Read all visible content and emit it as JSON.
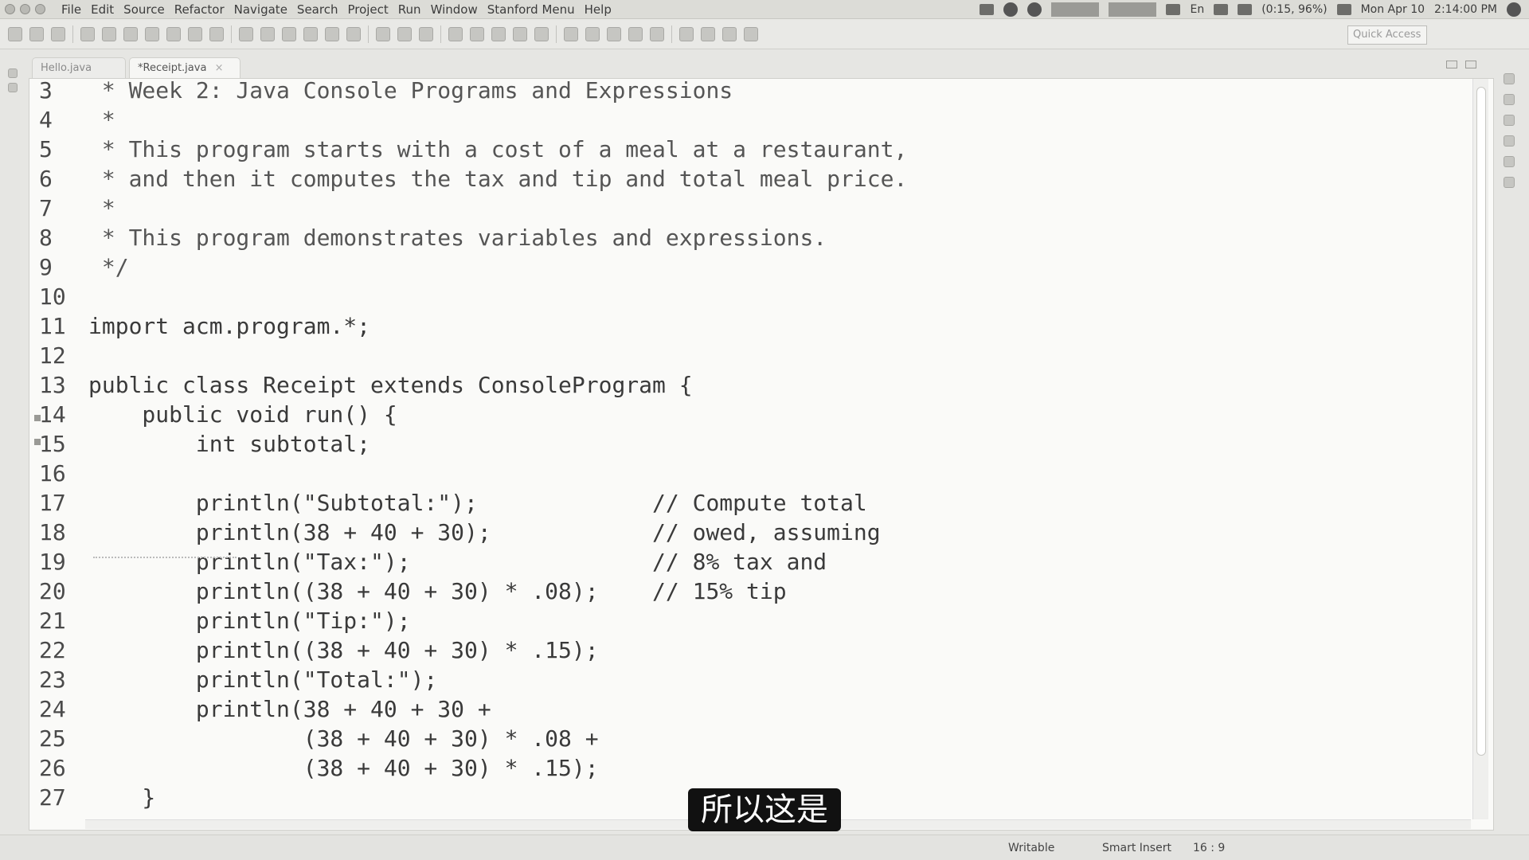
{
  "menubar": {
    "items": [
      "File",
      "Edit",
      "Source",
      "Refactor",
      "Navigate",
      "Search",
      "Project",
      "Run",
      "Window",
      "Stanford Menu",
      "Help"
    ],
    "battery": "(0:15, 96%)",
    "date": "Mon Apr 10",
    "time": "2:14:00 PM",
    "lang": "En"
  },
  "toolbar": {
    "quick_access": "Quick Access"
  },
  "tabs": [
    {
      "label": "Hello.java",
      "active": false
    },
    {
      "label": "*Receipt.java",
      "active": true
    }
  ],
  "editor": {
    "lines": [
      {
        "num": "3",
        "text": " * Week 2: Java Console Programs and Expressions"
      },
      {
        "num": "4",
        "text": " *"
      },
      {
        "num": "5",
        "text": " * This program starts with a cost of a meal at a restaurant,"
      },
      {
        "num": "6",
        "text": " * and then it computes the tax and tip and total meal price."
      },
      {
        "num": "7",
        "text": " *"
      },
      {
        "num": "8",
        "text": " * This program demonstrates variables and expressions."
      },
      {
        "num": "9",
        "text": " */"
      },
      {
        "num": "10",
        "text": ""
      },
      {
        "num": "11",
        "text": "import acm.program.*;"
      },
      {
        "num": "12",
        "text": ""
      },
      {
        "num": "13",
        "text": "public class Receipt extends ConsoleProgram {"
      },
      {
        "num": "14",
        "text": "    public void run() {"
      },
      {
        "num": "15",
        "text": "        int subtotal;"
      },
      {
        "num": "16",
        "text": ""
      },
      {
        "num": "17",
        "text": "        println(\"Subtotal:\");             // Compute total"
      },
      {
        "num": "18",
        "text": "        println(38 + 40 + 30);            // owed, assuming"
      },
      {
        "num": "19",
        "text": "        println(\"Tax:\");                  // 8% tax and"
      },
      {
        "num": "20",
        "text": "        println((38 + 40 + 30) * .08);    // 15% tip"
      },
      {
        "num": "21",
        "text": "        println(\"Tip:\");"
      },
      {
        "num": "22",
        "text": "        println((38 + 40 + 30) * .15);"
      },
      {
        "num": "23",
        "text": "        println(\"Total:\");"
      },
      {
        "num": "24",
        "text": "        println(38 + 40 + 30 +"
      },
      {
        "num": "25",
        "text": "                (38 + 40 + 30) * .08 +"
      },
      {
        "num": "26",
        "text": "                (38 + 40 + 30) * .15);"
      },
      {
        "num": "27",
        "text": "    }"
      }
    ]
  },
  "subtitle": "所以这是",
  "status": {
    "writable": "Writable",
    "insert_mode": "Smart Insert",
    "position": "16 : 9"
  }
}
